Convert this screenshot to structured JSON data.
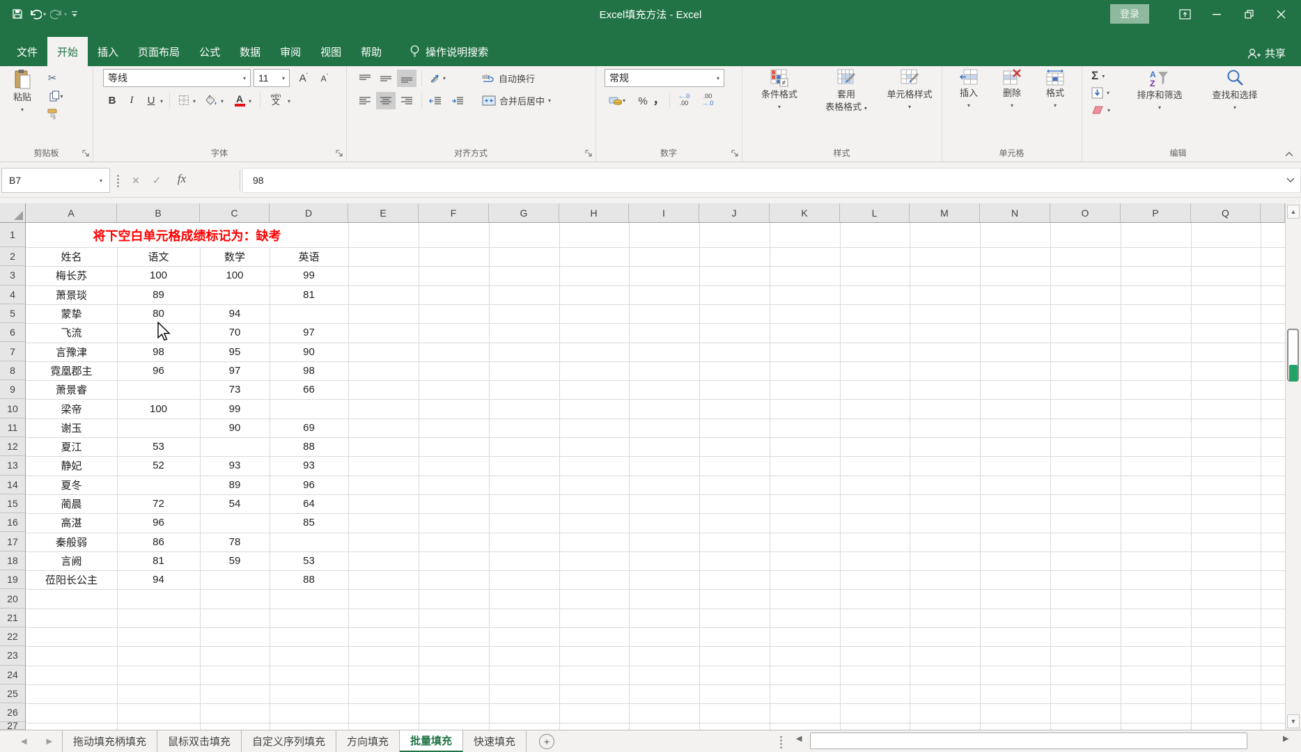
{
  "colors": {
    "accent": "#217346",
    "banner_red": "#ff0000"
  },
  "title_bar": {
    "title": "Excel填充方法 - Excel",
    "login": "登录"
  },
  "menu": {
    "tabs": [
      {
        "label": "文件",
        "active": false
      },
      {
        "label": "开始",
        "active": true
      },
      {
        "label": "插入",
        "active": false
      },
      {
        "label": "页面布局",
        "active": false
      },
      {
        "label": "公式",
        "active": false
      },
      {
        "label": "数据",
        "active": false
      },
      {
        "label": "审阅",
        "active": false
      },
      {
        "label": "视图",
        "active": false
      },
      {
        "label": "帮助",
        "active": false
      }
    ],
    "search": "操作说明搜索",
    "share": "共享"
  },
  "ribbon": {
    "clipboard": {
      "label": "剪贴板",
      "paste": "粘贴"
    },
    "font": {
      "label": "字体",
      "name": "等线",
      "size": "11",
      "bold": "B",
      "italic": "I",
      "underline": "U",
      "phonetic_top": "wén",
      "phonetic": "文"
    },
    "alignment": {
      "label": "对齐方式",
      "wrap": "自动换行",
      "merge": "合并后居中"
    },
    "number": {
      "label": "数字",
      "format": "常规",
      "percent": "%",
      "comma": "，",
      "inc_top": "←.0",
      "inc_bottom": ".00",
      "dec_top": ".00",
      "dec_bottom": "→.0"
    },
    "styles": {
      "label": "样式",
      "conditional": "条件格式",
      "table_line1": "套用",
      "table_line2": "表格格式",
      "cell_styles": "单元格样式"
    },
    "cells": {
      "label": "单元格",
      "insert": "插入",
      "delete": "删除",
      "format": "格式"
    },
    "editing": {
      "label": "编辑",
      "sigma": "Σ",
      "sort": "排序和筛选",
      "find": "查找和选择"
    }
  },
  "formula_bar": {
    "name_box": "B7",
    "fx": "fx",
    "content": "98"
  },
  "grid": {
    "columns": [
      "A",
      "B",
      "C",
      "D",
      "E",
      "F",
      "G",
      "H",
      "I",
      "J",
      "K",
      "L",
      "M",
      "N",
      "O",
      "P",
      "Q"
    ],
    "num_rows": 27,
    "banner": "将下空白单元格成绩标记为：缺考",
    "table": {
      "headers": [
        "姓名",
        "语文",
        "数学",
        "英语"
      ],
      "rows": [
        [
          "梅长苏",
          "100",
          "100",
          "99"
        ],
        [
          "萧景琰",
          "89",
          "",
          "81"
        ],
        [
          "蒙挚",
          "80",
          "94",
          ""
        ],
        [
          "飞流",
          "",
          "70",
          "97"
        ],
        [
          "言豫津",
          "98",
          "95",
          "90"
        ],
        [
          "霓凰郡主",
          "96",
          "97",
          "98"
        ],
        [
          "萧景睿",
          "",
          "73",
          "66"
        ],
        [
          "梁帝",
          "100",
          "99",
          ""
        ],
        [
          "谢玉",
          "",
          "90",
          "69"
        ],
        [
          "夏江",
          "53",
          "",
          "88"
        ],
        [
          "静妃",
          "52",
          "93",
          "93"
        ],
        [
          "夏冬",
          "",
          "89",
          "96"
        ],
        [
          "蔺晨",
          "72",
          "54",
          "64"
        ],
        [
          "高湛",
          "96",
          "",
          "85"
        ],
        [
          "秦般弱",
          "86",
          "78",
          ""
        ],
        [
          "言阙",
          "81",
          "59",
          "53"
        ],
        [
          "莅阳长公主",
          "94",
          "",
          "88"
        ]
      ]
    }
  },
  "sheet_bar": {
    "tabs": [
      {
        "label": "拖动填充柄填充",
        "active": false
      },
      {
        "label": "鼠标双击填充",
        "active": false
      },
      {
        "label": "自定义序列填充",
        "active": false
      },
      {
        "label": "方向填充",
        "active": false
      },
      {
        "label": "批量填充",
        "active": true
      },
      {
        "label": "快速填充",
        "active": false
      }
    ]
  }
}
